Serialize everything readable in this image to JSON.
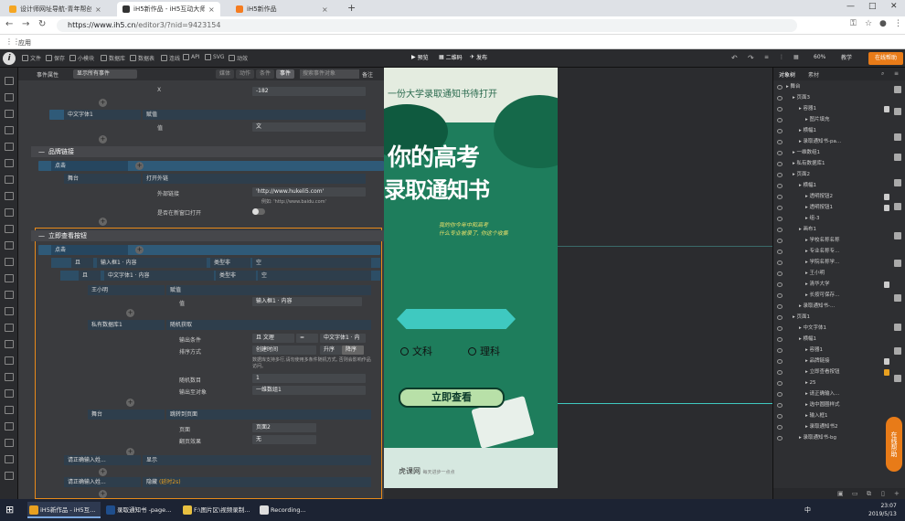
{
  "browser": {
    "tabs": [
      {
        "label": "设计师网址导航-青年帮创意工...",
        "fav": "#f5a623",
        "active": false
      },
      {
        "label": "iH5新作品 - iH5互动大师超级编辑",
        "fav": "#333333",
        "active": true
      },
      {
        "label": "iH5新作品",
        "fav": "#f57c20",
        "active": false
      }
    ],
    "url_host": "https://www.ih5.cn",
    "url_rest": "/editor3/?nid=9423154",
    "bookmark": "应用"
  },
  "toolbar": {
    "items": [
      "文件",
      "保存",
      "小模块",
      "数据库",
      "数据表",
      "连线",
      "API",
      "SVG",
      "动效"
    ],
    "preview": "预览",
    "qrcode": "二维码",
    "publish": "发布",
    "zoom": "60%",
    "teach": "教学",
    "help": "在线帮助"
  },
  "events": {
    "header_label": "事件属性",
    "filter": "显示所有事件",
    "tabs": [
      {
        "label": "媒体",
        "on": false
      },
      {
        "label": "动作",
        "on": false
      },
      {
        "label": "条件",
        "on": false
      },
      {
        "label": "事件",
        "on": true
      }
    ],
    "search_placeholder": "搜索事件对象",
    "note": "备注",
    "top": {
      "x_label": "X",
      "x_value": "-182",
      "obj": "中文字体1",
      "action": "赋值",
      "val_label": "值",
      "val_value": "文"
    },
    "brand": {
      "title": "品牌链接",
      "trigger": "点击",
      "obj": "舞台",
      "action": "打开外链",
      "link_label": "外部链接",
      "link_value": "'http://www.hukeli5.com'",
      "link_hint": "例如: 'http://www.baidu.com'",
      "newwin_label": "是否在新窗口打开"
    },
    "view": {
      "title": "立即查看按钮",
      "trigger": "点击",
      "cond1_a": "且",
      "cond1_b": "输入框1 · 内容",
      "cond1_c": "类型非",
      "cond1_d": "空",
      "cond2_a": "且",
      "cond2_b": "中文字体1 · 内容",
      "cond2_c": "类型非",
      "cond2_d": "空",
      "a1_obj": "王小明",
      "a1_action": "赋值",
      "a1_val_label": "值",
      "a1_val": "输入框1 · 内容",
      "a2_obj": "私有数据库1",
      "a2_action": "随机获取",
      "out_cond_label": "输出条件",
      "out_cond_a": "且 文理",
      "out_cond_b": "=",
      "out_cond_c": "中文字体1 · 内",
      "sort_label": "排序方式",
      "sort_value": "创建时间",
      "asc": "升序",
      "desc": "降序",
      "sort_hint": "数据库支持多行,请勿使用多条件随机方式, 否则会影响作品访问。",
      "count_label": "随机数目",
      "count_value": "1",
      "out_obj_label": "输出至对象",
      "out_obj_value": "一维数组1",
      "a3_obj": "舞台",
      "a3_action": "跳转到页面",
      "page_label": "页面",
      "page_value": "页面2",
      "flip_label": "翻页效果",
      "flip_value": "无",
      "a4_obj": "请正确输入姓...",
      "a4_action": "显示",
      "a5_obj": "请正确输入姓...",
      "a5_action": "隐藏",
      "a5_delay": "(延时2s)"
    }
  },
  "canvas": {
    "top_text": "一份大学录取通知书待打开",
    "title1": "你的高考",
    "title2": "录取通知书",
    "sub1": "我的你今年中和高考",
    "sub2": "什么专业被录了, 你这个收集",
    "radio1": "文科",
    "radio2": "理科",
    "button": "立即查看",
    "brand": "虎课网",
    "brand_sub": "每天进步一点点"
  },
  "layers": {
    "tab1": "对象树",
    "tab2": "素材",
    "items": [
      {
        "label": "舞台",
        "indent": 0,
        "lock": ""
      },
      {
        "label": "页面3",
        "indent": 1,
        "lock": ""
      },
      {
        "label": "容器1",
        "indent": 2,
        "lock": "w"
      },
      {
        "label": "图片填充",
        "indent": 3,
        "lock": ""
      },
      {
        "label": "横幅1",
        "indent": 2,
        "lock": ""
      },
      {
        "label": "录取通知书-pa...",
        "indent": 2,
        "lock": ""
      },
      {
        "label": "一维数组1",
        "indent": 1,
        "lock": ""
      },
      {
        "label": "私有数据库1",
        "indent": 1,
        "lock": ""
      },
      {
        "label": "页面2",
        "indent": 1,
        "lock": ""
      },
      {
        "label": "横幅1",
        "indent": 2,
        "lock": ""
      },
      {
        "label": "透明按钮2",
        "indent": 3,
        "lock": "w"
      },
      {
        "label": "透明按钮1",
        "indent": 3,
        "lock": "w"
      },
      {
        "label": "组-3",
        "indent": 3,
        "lock": ""
      },
      {
        "label": "画布1",
        "indent": 2,
        "lock": ""
      },
      {
        "label": "学校名称名称",
        "indent": 3,
        "lock": ""
      },
      {
        "label": "专业名称专...",
        "indent": 3,
        "lock": ""
      },
      {
        "label": "学院名称学...",
        "indent": 3,
        "lock": ""
      },
      {
        "label": "王小明",
        "indent": 3,
        "lock": ""
      },
      {
        "label": "清华大学",
        "indent": 3,
        "lock": "w"
      },
      {
        "label": "长按可保存...",
        "indent": 3,
        "lock": ""
      },
      {
        "label": "录取通知书-...",
        "indent": 2,
        "lock": ""
      },
      {
        "label": "页面1",
        "indent": 1,
        "lock": ""
      },
      {
        "label": "中文字体1",
        "indent": 2,
        "lock": ""
      },
      {
        "label": "横幅1",
        "indent": 2,
        "lock": ""
      },
      {
        "label": "容器1",
        "indent": 3,
        "lock": ""
      },
      {
        "label": "品牌链接",
        "indent": 3,
        "lock": "w"
      },
      {
        "label": "立即查看按钮",
        "indent": 3,
        "lock": "o"
      },
      {
        "label": "25",
        "indent": 3,
        "lock": ""
      },
      {
        "label": "请正确输入...",
        "indent": 3,
        "lock": ""
      },
      {
        "label": "选中圆圈样式",
        "indent": 3,
        "lock": ""
      },
      {
        "label": "输入框1",
        "indent": 3,
        "lock": ""
      },
      {
        "label": "录取通知书2",
        "indent": 3,
        "lock": ""
      },
      {
        "label": "录取通知书-bg",
        "indent": 2,
        "lock": ""
      }
    ],
    "online_help": "在线帮助"
  },
  "taskbar": {
    "items": [
      {
        "label": "iH5新作品 - iH5互...",
        "color": "#e8a020",
        "active": true
      },
      {
        "label": "录取通知书 -page...",
        "color": "#1f4e8c",
        "active": false
      },
      {
        "label": "F:\\图片区\\视频录制...",
        "color": "#e8c040",
        "active": false
      },
      {
        "label": "Recording...",
        "color": "#dddddd",
        "active": false
      }
    ],
    "time": "23:07",
    "date": "2019/5/13",
    "tray": "中"
  }
}
